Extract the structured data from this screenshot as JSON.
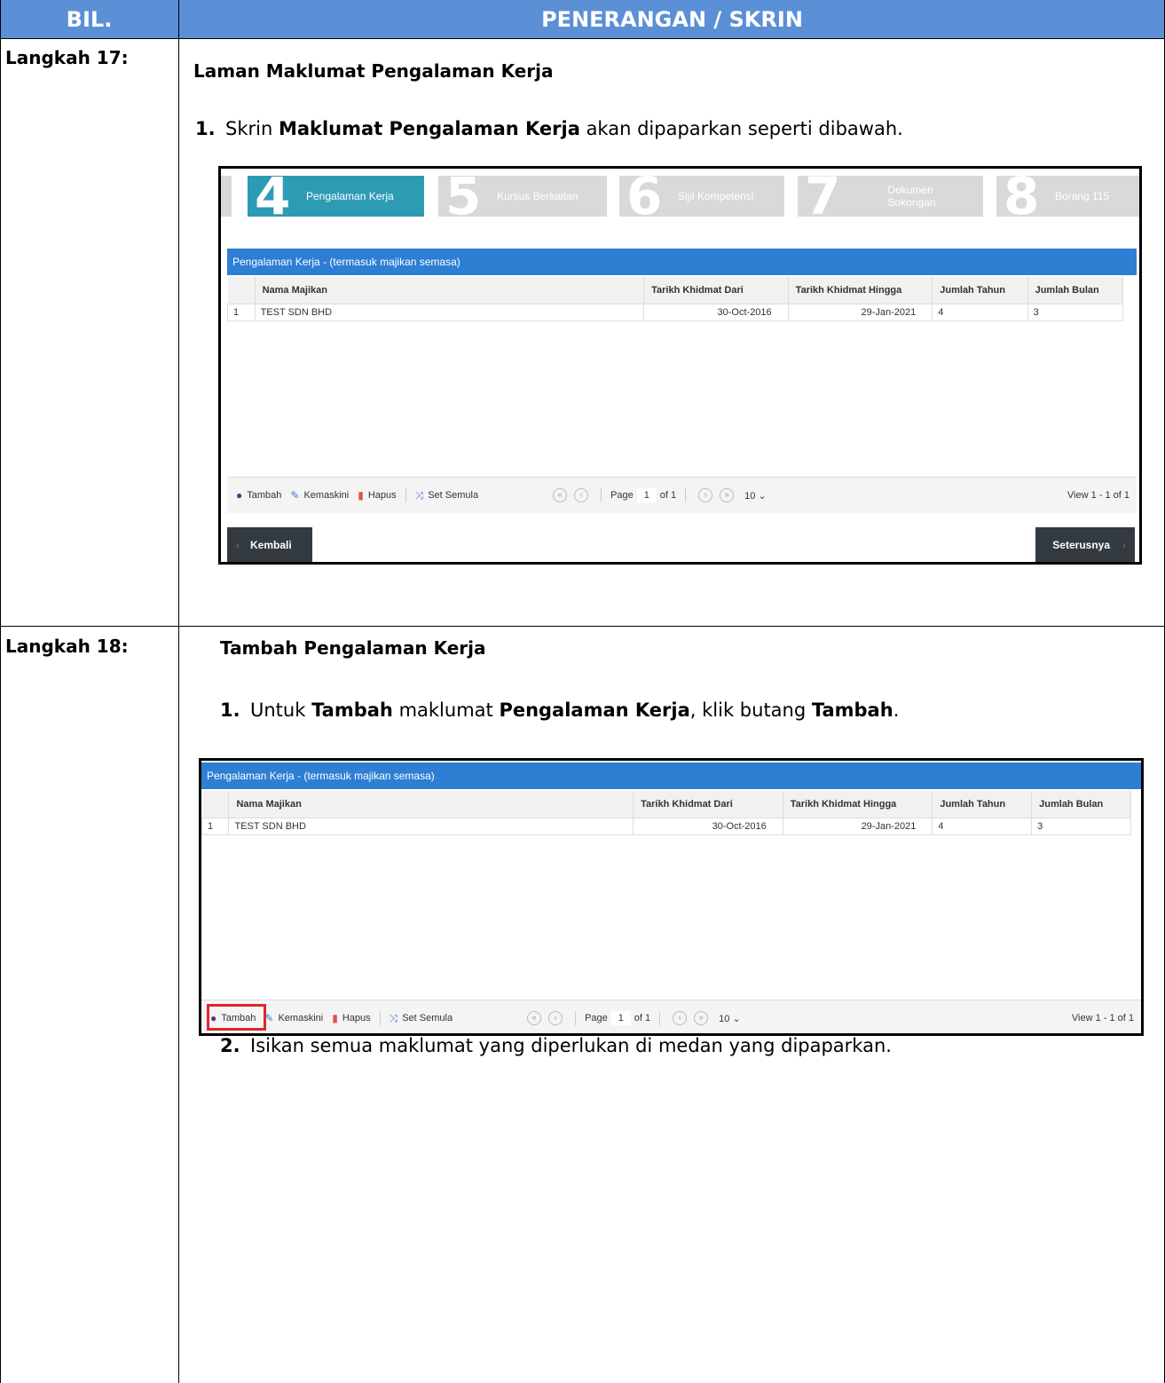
{
  "header": {
    "bil": "BIL.",
    "penerangan": "PENERANGAN / SKRIN"
  },
  "step17": {
    "label": "Langkah 17:",
    "title": "Laman Maklumat Pengalaman Kerja",
    "item1_num": "1.",
    "item1_pre": "Skrin ",
    "item1_bold": "Maklumat Pengalaman Kerja",
    "item1_post": " akan dipaparkan seperti dibawah."
  },
  "step18": {
    "label": "Langkah 18:",
    "title": "Tambah Pengalaman Kerja",
    "item1_num": "1.",
    "item1_a": "Untuk ",
    "item1_b": "Tambah",
    "item1_c": " maklumat ",
    "item1_d": "Pengalaman Kerja",
    "item1_e": ", klik butang ",
    "item1_f": "Tambah",
    "item1_g": ".",
    "item2_num": "2.",
    "item2_text": "Isikan semua maklumat yang diperlukan di medan yang dipaparkan."
  },
  "wizard": {
    "steps": [
      {
        "num": "4",
        "label": "Pengalaman Kerja"
      },
      {
        "num": "5",
        "label": "Kursus Berkaitan"
      },
      {
        "num": "6",
        "label": "Sijil Kompetensi"
      },
      {
        "num": "7",
        "label": "Dokumen Sokongan"
      },
      {
        "num": "8",
        "label": "Borang 115"
      }
    ]
  },
  "grid": {
    "title": "Pengalaman Kerja - (termasuk majikan semasa)",
    "columns": [
      "Nama Majikan",
      "Tarikh Khidmat Dari",
      "Tarikh Khidmat Hingga",
      "Jumlah Tahun",
      "Jumlah Bulan"
    ],
    "rows": [
      {
        "no": "1",
        "nama": "TEST SDN BHD",
        "dari": "30-Oct-2016",
        "hingga": "29-Jan-2021",
        "tahun": "4",
        "bulan": "3"
      }
    ]
  },
  "pager": {
    "tambah": "Tambah",
    "kemaskini": "Kemaskini",
    "hapus": "Hapus",
    "set_semula": "Set Semula",
    "page_label": "Page",
    "page_value": "1",
    "of_label": "of 1",
    "per_page": "10",
    "view": "View 1 - 1 of 1"
  },
  "nav": {
    "back": "Kembali",
    "next": "Seterusnya"
  },
  "colors": {
    "header": "#5B8FD6",
    "grid_title": "#2e7fd3",
    "active_step": "#2e9bb5",
    "highlight": "#e0262c"
  }
}
